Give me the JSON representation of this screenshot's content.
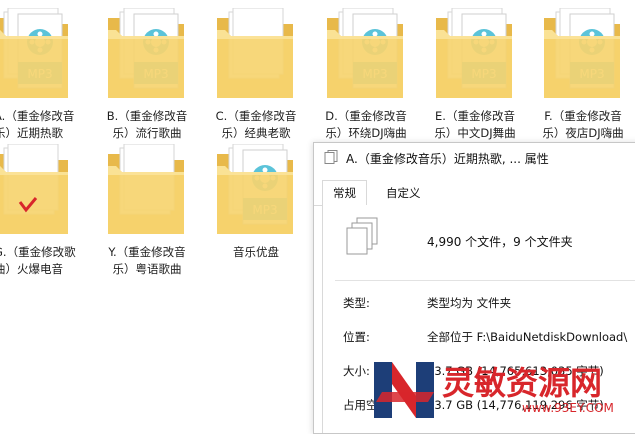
{
  "folders": [
    {
      "id": "a",
      "label": "A.（重金修改音\n乐）近期热歌",
      "icon": "mp3-folder-icon"
    },
    {
      "id": "b",
      "label": "B.（重金修改音\n乐）流行歌曲",
      "icon": "mp3-folder-icon"
    },
    {
      "id": "c",
      "label": "C.（重金修改音\n乐）经典老歌",
      "icon": "folder-icon"
    },
    {
      "id": "d",
      "label": "D.（重金修改音\n乐）环绕DJ嗨曲",
      "icon": "mp3-folder-icon"
    },
    {
      "id": "e",
      "label": "E.（重金修改音\n乐）中文DJ舞曲",
      "icon": "mp3-folder-icon"
    },
    {
      "id": "f",
      "label": "F.（重金修改音\n乐）夜店DJ嗨曲",
      "icon": "mp3-folder-icon"
    },
    {
      "id": "g",
      "label": "G.（重金修改歌\n曲）火爆电音",
      "icon": "folder-icon"
    },
    {
      "id": "y",
      "label": "Y.（重金修改音\n乐）粤语歌曲",
      "icon": "folder-icon"
    },
    {
      "id": "z",
      "label": "音乐优盘",
      "icon": "mp3-folder-icon"
    }
  ],
  "dialog": {
    "title": "A.（重金修改音乐）近期热歌, ... 属性",
    "tabs": [
      "常规",
      "自定义"
    ],
    "summary": "4,990 个文件，9 个文件夹",
    "type_label": "类型:",
    "type_value": "类型均为 文件夹",
    "location_label": "位置:",
    "location_value": "全部位于 F:\\BaiduNetdiskDownload\\",
    "size_label": "大小:",
    "size_value": "13.7 GB (14,765,613,035 字节)",
    "disk_label": "占用空间:",
    "disk_value": "13.7 GB (14,776,119,296 字节)"
  },
  "watermark": {
    "logo_text": "灵敏资源网",
    "url": "www.93EY.COM"
  },
  "colors": {
    "folder_back": "#f0c75e",
    "folder_front": "#f8d978",
    "mp3_teal": "#5bc3d9",
    "logo_navy": "#1d3e78",
    "logo_red": "#d8262b"
  }
}
